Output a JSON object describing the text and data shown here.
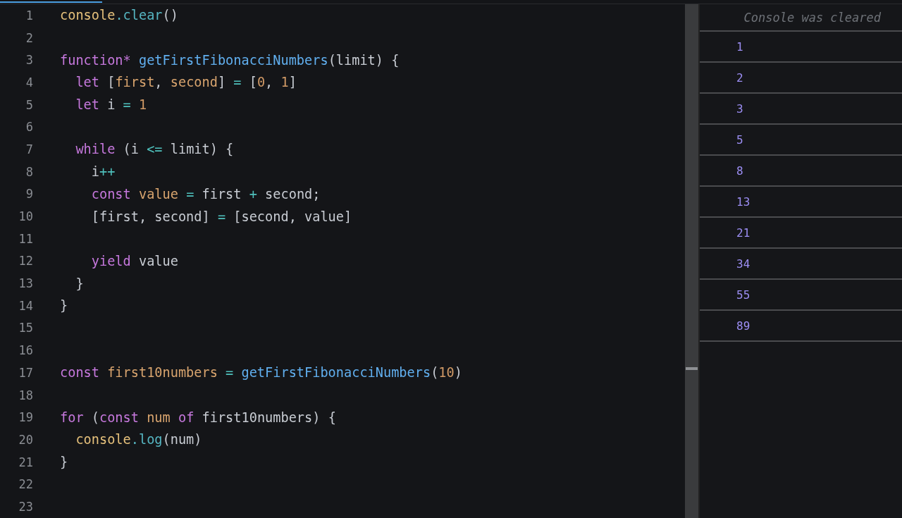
{
  "editor": {
    "lines": [
      {
        "number": "1",
        "tokens": [
          {
            "text": "console",
            "kind": "object"
          },
          {
            "text": ".clear",
            "kind": "method"
          },
          {
            "text": "()",
            "kind": "plain"
          }
        ]
      },
      {
        "number": "2"
      },
      {
        "number": "3",
        "tokens": [
          {
            "text": "function* ",
            "kind": "keyword"
          },
          {
            "text": "getFirstFibonacciNumbers",
            "kind": "function"
          },
          {
            "text": "(limit) {",
            "kind": "plain"
          }
        ]
      },
      {
        "number": "4",
        "tokens": [
          {
            "text": "  let",
            "kind": "keyword"
          },
          {
            "text": " [",
            "kind": "plain"
          },
          {
            "text": "first",
            "kind": "variable"
          },
          {
            "text": ", ",
            "kind": "plain"
          },
          {
            "text": "second",
            "kind": "variable"
          },
          {
            "text": "] ",
            "kind": "plain"
          },
          {
            "text": "= ",
            "kind": "operator"
          },
          {
            "text": "[",
            "kind": "plain"
          },
          {
            "text": "0",
            "kind": "number"
          },
          {
            "text": ", ",
            "kind": "plain"
          },
          {
            "text": "1",
            "kind": "number"
          },
          {
            "text": "]",
            "kind": "plain"
          }
        ]
      },
      {
        "number": "5",
        "tokens": [
          {
            "text": "  let",
            "kind": "keyword"
          },
          {
            "text": " i ",
            "kind": "plain"
          },
          {
            "text": "= ",
            "kind": "operator"
          },
          {
            "text": "1",
            "kind": "number"
          }
        ]
      },
      {
        "number": "6"
      },
      {
        "number": "7",
        "tokens": [
          {
            "text": "  while",
            "kind": "keyword"
          },
          {
            "text": " (i ",
            "kind": "plain"
          },
          {
            "text": "<=",
            "kind": "operator"
          },
          {
            "text": " limit) {",
            "kind": "plain"
          }
        ]
      },
      {
        "number": "8",
        "tokens": [
          {
            "text": "    i",
            "kind": "plain"
          },
          {
            "text": "++",
            "kind": "operator"
          }
        ]
      },
      {
        "number": "9",
        "tokens": [
          {
            "text": "    const ",
            "kind": "keyword"
          },
          {
            "text": "value ",
            "kind": "variable"
          },
          {
            "text": "=",
            "kind": "operator"
          },
          {
            "text": " first ",
            "kind": "plain"
          },
          {
            "text": "+",
            "kind": "operator"
          },
          {
            "text": " second;",
            "kind": "plain"
          }
        ]
      },
      {
        "number": "10",
        "tokens": [
          {
            "text": "    [first, second] ",
            "kind": "plain"
          },
          {
            "text": "=",
            "kind": "operator"
          },
          {
            "text": " [second, value]",
            "kind": "plain"
          }
        ]
      },
      {
        "number": "11"
      },
      {
        "number": "12",
        "tokens": [
          {
            "text": "    yield",
            "kind": "keyword"
          },
          {
            "text": " value",
            "kind": "plain"
          }
        ]
      },
      {
        "number": "13",
        "tokens": [
          {
            "text": "  }",
            "kind": "plain"
          }
        ]
      },
      {
        "number": "14",
        "tokens": [
          {
            "text": "}",
            "kind": "plain"
          }
        ]
      },
      {
        "number": "15"
      },
      {
        "number": "16"
      },
      {
        "number": "17",
        "tokens": [
          {
            "text": "const ",
            "kind": "keyword"
          },
          {
            "text": "first10numbers ",
            "kind": "variable"
          },
          {
            "text": "= ",
            "kind": "operator"
          },
          {
            "text": "getFirstFibonacciNumbers",
            "kind": "function"
          },
          {
            "text": "(",
            "kind": "plain"
          },
          {
            "text": "10",
            "kind": "number"
          },
          {
            "text": ")",
            "kind": "plain"
          }
        ]
      },
      {
        "number": "18"
      },
      {
        "number": "19",
        "tokens": [
          {
            "text": "for",
            "kind": "keyword"
          },
          {
            "text": " (",
            "kind": "plain"
          },
          {
            "text": "const ",
            "kind": "keyword"
          },
          {
            "text": "num ",
            "kind": "variable"
          },
          {
            "text": "of",
            "kind": "keyword"
          },
          {
            "text": " first10numbers) {",
            "kind": "plain"
          }
        ]
      },
      {
        "number": "20",
        "tokens": [
          {
            "text": "  console",
            "kind": "object"
          },
          {
            "text": ".log",
            "kind": "method"
          },
          {
            "text": "(num)",
            "kind": "plain"
          }
        ]
      },
      {
        "number": "21",
        "tokens": [
          {
            "text": "}",
            "kind": "plain"
          }
        ]
      },
      {
        "number": "22"
      },
      {
        "number": "23"
      }
    ]
  },
  "console": {
    "notice": "Console was cleared",
    "entries": [
      "1",
      "2",
      "3",
      "5",
      "8",
      "13",
      "21",
      "34",
      "55",
      "89"
    ]
  }
}
